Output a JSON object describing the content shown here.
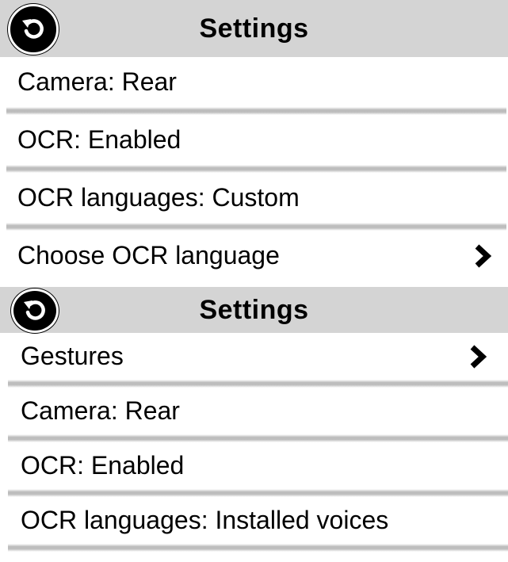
{
  "screens": [
    {
      "header": {
        "title": "Settings"
      },
      "items": [
        {
          "label": "Camera: Rear",
          "has_chevron": false
        },
        {
          "label": "OCR: Enabled",
          "has_chevron": false
        },
        {
          "label": "OCR languages: Custom",
          "has_chevron": false
        },
        {
          "label": "Choose OCR language",
          "has_chevron": true
        }
      ]
    },
    {
      "header": {
        "title": "Settings"
      },
      "items": [
        {
          "label": "Gestures",
          "has_chevron": true
        },
        {
          "label": "Camera: Rear",
          "has_chevron": false
        },
        {
          "label": "OCR: Enabled",
          "has_chevron": false
        },
        {
          "label": "OCR languages: Installed voices",
          "has_chevron": false
        }
      ]
    }
  ],
  "icons": {
    "back": "back-arrow-circle-icon",
    "chevron": "chevron-right-icon"
  },
  "colors": {
    "header_bg": "#d4d4d4",
    "divider": "#bdbdbd",
    "text": "#000000",
    "background": "#ffffff"
  }
}
